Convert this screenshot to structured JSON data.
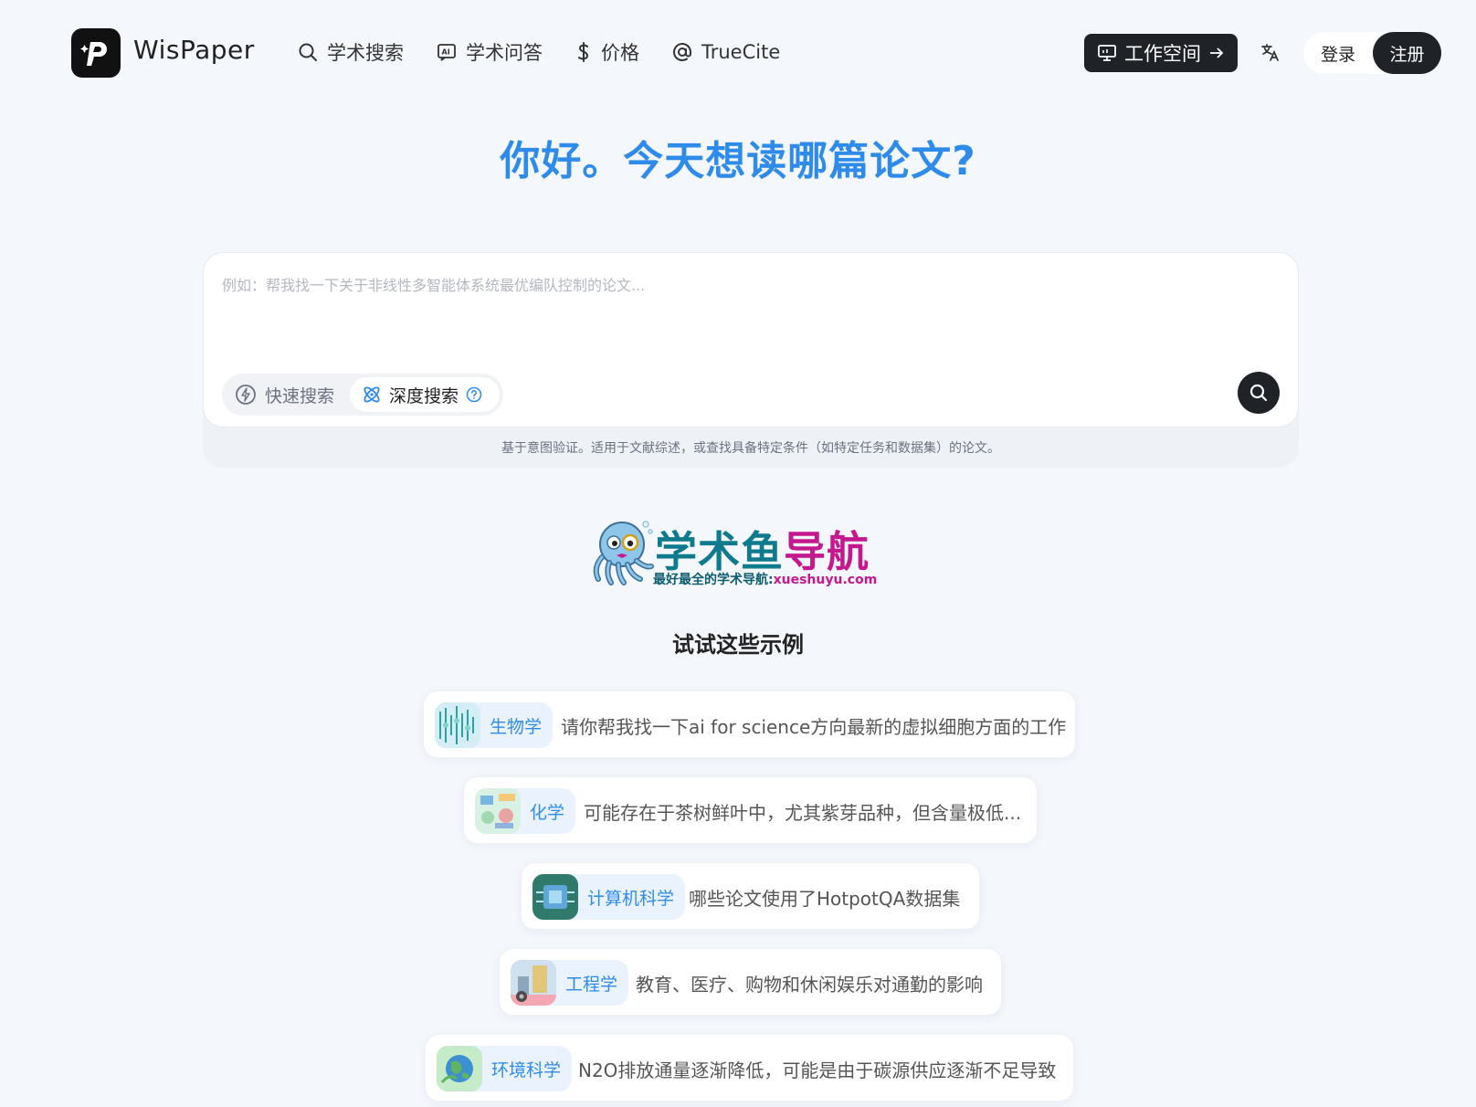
{
  "header": {
    "brand": "WisPaper",
    "nav": [
      {
        "label": "学术搜索",
        "icon": "search-icon"
      },
      {
        "label": "学术问答",
        "icon": "ai-chat-icon"
      },
      {
        "label": "价格",
        "icon": "dollar-icon"
      },
      {
        "label": "TrueCite",
        "icon": "at-icon"
      }
    ],
    "workspace_label": "工作空间",
    "login_label": "登录",
    "register_label": "注册"
  },
  "hero": {
    "title": "你好。今天想读哪篇论文?"
  },
  "search": {
    "placeholder": "例如：帮我找一下关于非线性多智能体系统最优编队控制的论文...",
    "mode_fast": "快速搜索",
    "mode_deep": "深度搜索",
    "active_mode": "深度搜索",
    "hint": "基于意图验证。适用于文献综述，或查找具备特定条件（如特定任务和数据集）的论文。"
  },
  "banner": {
    "title_part1": "学术鱼",
    "title_part2": "导航",
    "subtitle_part1": "最好最全的学术导航:",
    "subtitle_part2": "xueshuyu.com"
  },
  "examples": {
    "title": "试试这些示例",
    "items": [
      {
        "tag": "生物学",
        "text": "请你帮我找一下ai for science方向最新的虚拟细胞方面的工作"
      },
      {
        "tag": "化学",
        "text": "可能存在于茶树鲜叶中，尤其紫芽品种，但含量极低..."
      },
      {
        "tag": "计算机科学",
        "text": "哪些论文使用了HotpotQA数据集"
      },
      {
        "tag": "工程学",
        "text": "教育、医疗、购物和休闲娱乐对通勤的影响"
      },
      {
        "tag": "环境科学",
        "text": "N2O排放通量逐渐降低，可能是由于碳源供应逐渐不足导致"
      }
    ]
  },
  "colors": {
    "accent": "#2f8bea",
    "dark": "#1f2227",
    "background": "#f4f7fc"
  }
}
